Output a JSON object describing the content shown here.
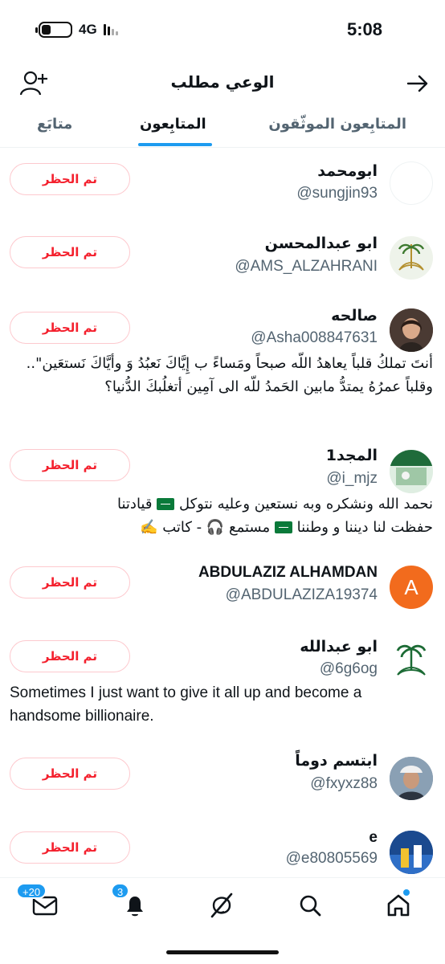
{
  "status_bar": {
    "time": "5:08",
    "network": "4G"
  },
  "header": {
    "title": "الوعي مطلب"
  },
  "tabs": [
    {
      "label": "المتابِعون الموثّقون"
    },
    {
      "label": "المتابِعون"
    },
    {
      "label": "متابَع"
    }
  ],
  "followers": [
    {
      "name": "ابومحمد",
      "handle": "@sungjin93",
      "button": "تم الحظر",
      "bio": ""
    },
    {
      "name": "ابو عبدالمحسن",
      "handle": "@AMS_ALZAHRANI",
      "button": "تم الحظر",
      "bio": ""
    },
    {
      "name": "صالحه",
      "handle": "@Asha008847631",
      "button": "تم الحظر",
      "bio": "أنتَ تملكُ قلباً يعاهدُ اللّه صبحاً ومَساءً ب إِيَّاكَ نَعبُدُ وَ وأيَّاكَ نَستعَين\".. وقلباً عمرُهُ يمتدُّ مابين الحَمدُ للّه الى آمِين أتغلُبكَ الدُّنيا؟"
    },
    {
      "name": "المجد1",
      "handle": "@i_mjz",
      "button": "تم الحظر",
      "bio_line1": "نحمد الله ونشكره وبه نستعين وعليه نتوكل",
      "bio_line1b": "قيادتنا",
      "bio_line2": "حفظت لنا ديننا و وطننا",
      "bio_line2b": "مستمع 🎧 - كاتب ✍️"
    },
    {
      "name": "ABDULAZIZ ALHAMDAN",
      "handle": "@ABDULAZIZA19374",
      "button": "تم الحظر",
      "avatar_letter": "A"
    },
    {
      "name": "ابو عبدالله",
      "handle": "@6g6og",
      "button": "تم الحظر",
      "bio": "Sometimes I just want to give it all up and become a handsome billionaire."
    },
    {
      "name": "ابتسم دوماً",
      "handle": "@fxyxz88",
      "button": "تم الحظر"
    },
    {
      "name": "e",
      "handle": "@e80805569",
      "button": "تم الحظر"
    }
  ],
  "bottom_nav": {
    "mail_badge": "+20",
    "notifications_badge": "3"
  },
  "colors": {
    "accent": "#1d9bf0",
    "blocked_red": "#f4212e",
    "secondary_text": "#536471",
    "avatar_orange": "#f26b1d"
  },
  "icons": [
    "add-user-icon",
    "back-arrow-icon",
    "mail-icon",
    "bell-icon",
    "grok-icon",
    "search-icon",
    "home-icon"
  ]
}
